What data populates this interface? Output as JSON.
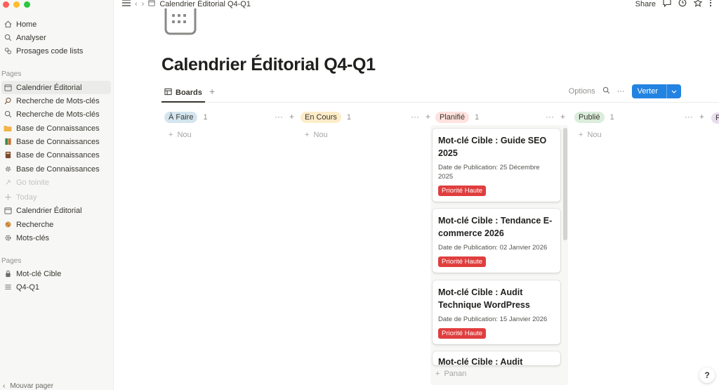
{
  "sidebar": {
    "top_items": [
      {
        "label": "Home",
        "icon": "home-icon"
      },
      {
        "label": "Analyser",
        "icon": "search-icon"
      },
      {
        "label": "Prosages code lists",
        "icon": "link-icon"
      }
    ],
    "section1_label": "Pages",
    "pages": [
      {
        "label": "Calendrier Éditorial",
        "icon": "calendar-icon"
      },
      {
        "label": "Recherche de Mots-clés",
        "icon": "search-icon"
      },
      {
        "label": "Recherche de Mots-clés",
        "icon": "search-icon"
      },
      {
        "label": "Base de Connaissances",
        "icon": "folder-icon"
      },
      {
        "label": "Base de Connaissances",
        "icon": "book-icon"
      },
      {
        "label": "Base de Connaissances",
        "icon": "book-icon"
      },
      {
        "label": "Base de Connaissances",
        "icon": "gear-icon"
      },
      {
        "label": "Go toinite",
        "icon": "pin-icon"
      },
      {
        "label": "Today",
        "icon": "plus-icon"
      },
      {
        "label": "Calendrier Éditorial",
        "icon": "calendar-icon"
      },
      {
        "label": "Recherche",
        "icon": "cookie-icon"
      },
      {
        "label": "Mots-clés",
        "icon": "gear-icon"
      }
    ],
    "section2_label": "Pages",
    "pages2": [
      {
        "label": "Mot-clé Cible",
        "icon": "lock-icon"
      },
      {
        "label": "Q4-Q1",
        "icon": "list-icon"
      }
    ],
    "bottom_label": "Mouvar pager"
  },
  "topbar": {
    "breadcrumb": "Calendrier Éditorial Q4-Q1",
    "share_label": "Share"
  },
  "page": {
    "title": "Calendrier Éditorial Q4-Q1"
  },
  "view": {
    "tab_label": "Boards",
    "options_label": "Options",
    "new_label": "Verter"
  },
  "board": {
    "columns": [
      {
        "name": "À Faire",
        "count": "1",
        "new_label": "Nou",
        "color": "#d3e5ef"
      },
      {
        "name": "En Cours",
        "count": "1",
        "new_label": "Nou",
        "color": "#fdecc8"
      },
      {
        "name": "Planifié",
        "count": "1",
        "color": "#ffe2dd"
      },
      {
        "name": "Publié",
        "count": "1",
        "new_label": "Nou",
        "color": "#dbeddb"
      },
      {
        "name": "P",
        "count": "",
        "color": "#e8deee"
      }
    ],
    "cards": [
      {
        "title": "Mot-clé Cible : Guide SEO 2025",
        "prop": "Date de Publication: 25 Décembre 2025",
        "tag": "Priorité Haute"
      },
      {
        "title": "Mot-clé Cible : Tendance E-commerce 2026",
        "prop": "Date de Publication: 02 Janvier 2026",
        "tag": "Priorité Haute"
      },
      {
        "title": "Mot-clé Cible : Audit Technique WordPress",
        "prop": "Date de Publication: 15 Janvier 2026",
        "tag": "Priorité Haute"
      },
      {
        "title": "Mot-clé Cible : Audit Techno",
        "prop": "",
        "tag": ""
      }
    ],
    "footer_new_label": "Panan"
  },
  "help_label": "?"
}
